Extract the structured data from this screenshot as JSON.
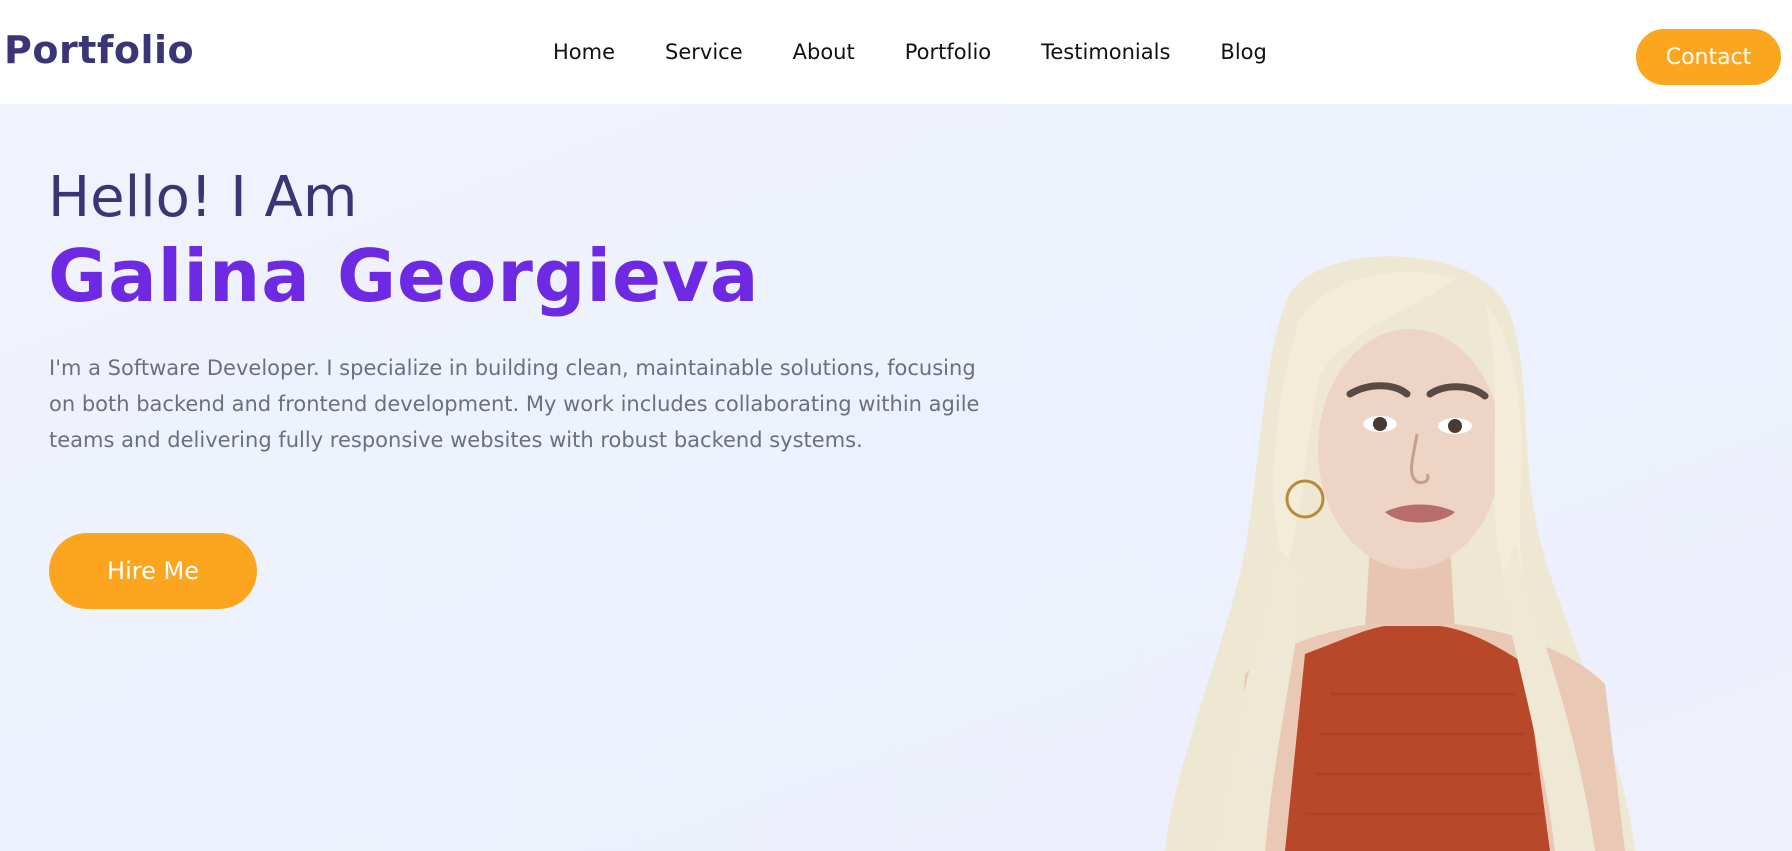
{
  "nav": {
    "logo": "Portfolio",
    "links": [
      "Home",
      "Service",
      "About",
      "Portfolio",
      "Testimonials",
      "Blog"
    ],
    "contact_label": "Contact"
  },
  "hero": {
    "greeting": "Hello! I Am",
    "name": "Galina Georgieva",
    "bio": "I'm a Software Developer. I specialize in building clean, maintainable solutions, focusing on both backend and frontend development. My work includes collaborating within agile teams and delivering fully responsive websites with robust backend systems.",
    "hire_label": "Hire Me"
  },
  "colors": {
    "accent": "#fca61f",
    "name": "#6d2ae2",
    "heading": "#3b3576"
  }
}
